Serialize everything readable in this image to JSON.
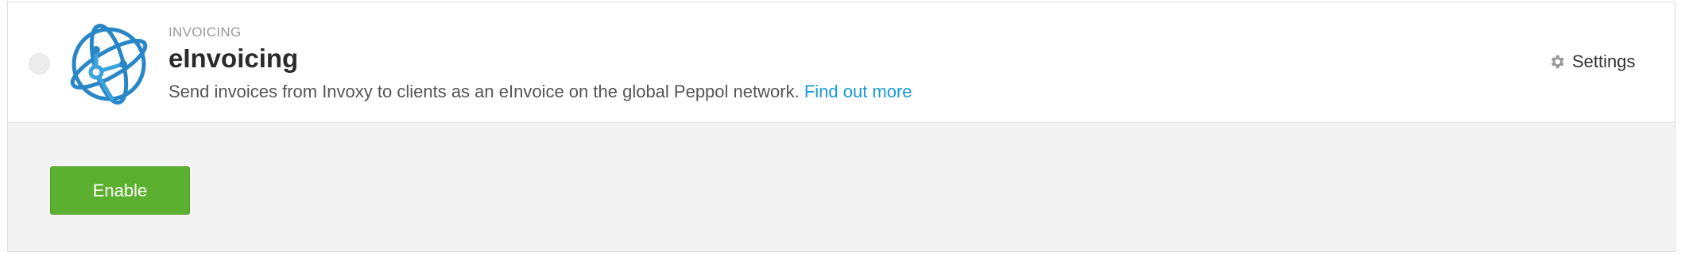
{
  "app": {
    "category": "INVOICING",
    "title": "eInvoicing",
    "description": "Send invoices from Invoxy to clients as an eInvoice on the global Peppol network.",
    "find_out_more": "Find out more",
    "logo_icon": "globe-network-icon"
  },
  "header_actions": {
    "settings_label": "Settings",
    "settings_icon": "gear-icon"
  },
  "body": {
    "enable_label": "Enable"
  },
  "colors": {
    "accent_green": "#5bb12f",
    "link_blue": "#1a9ad6",
    "logo_blue": "#2a87c7"
  }
}
